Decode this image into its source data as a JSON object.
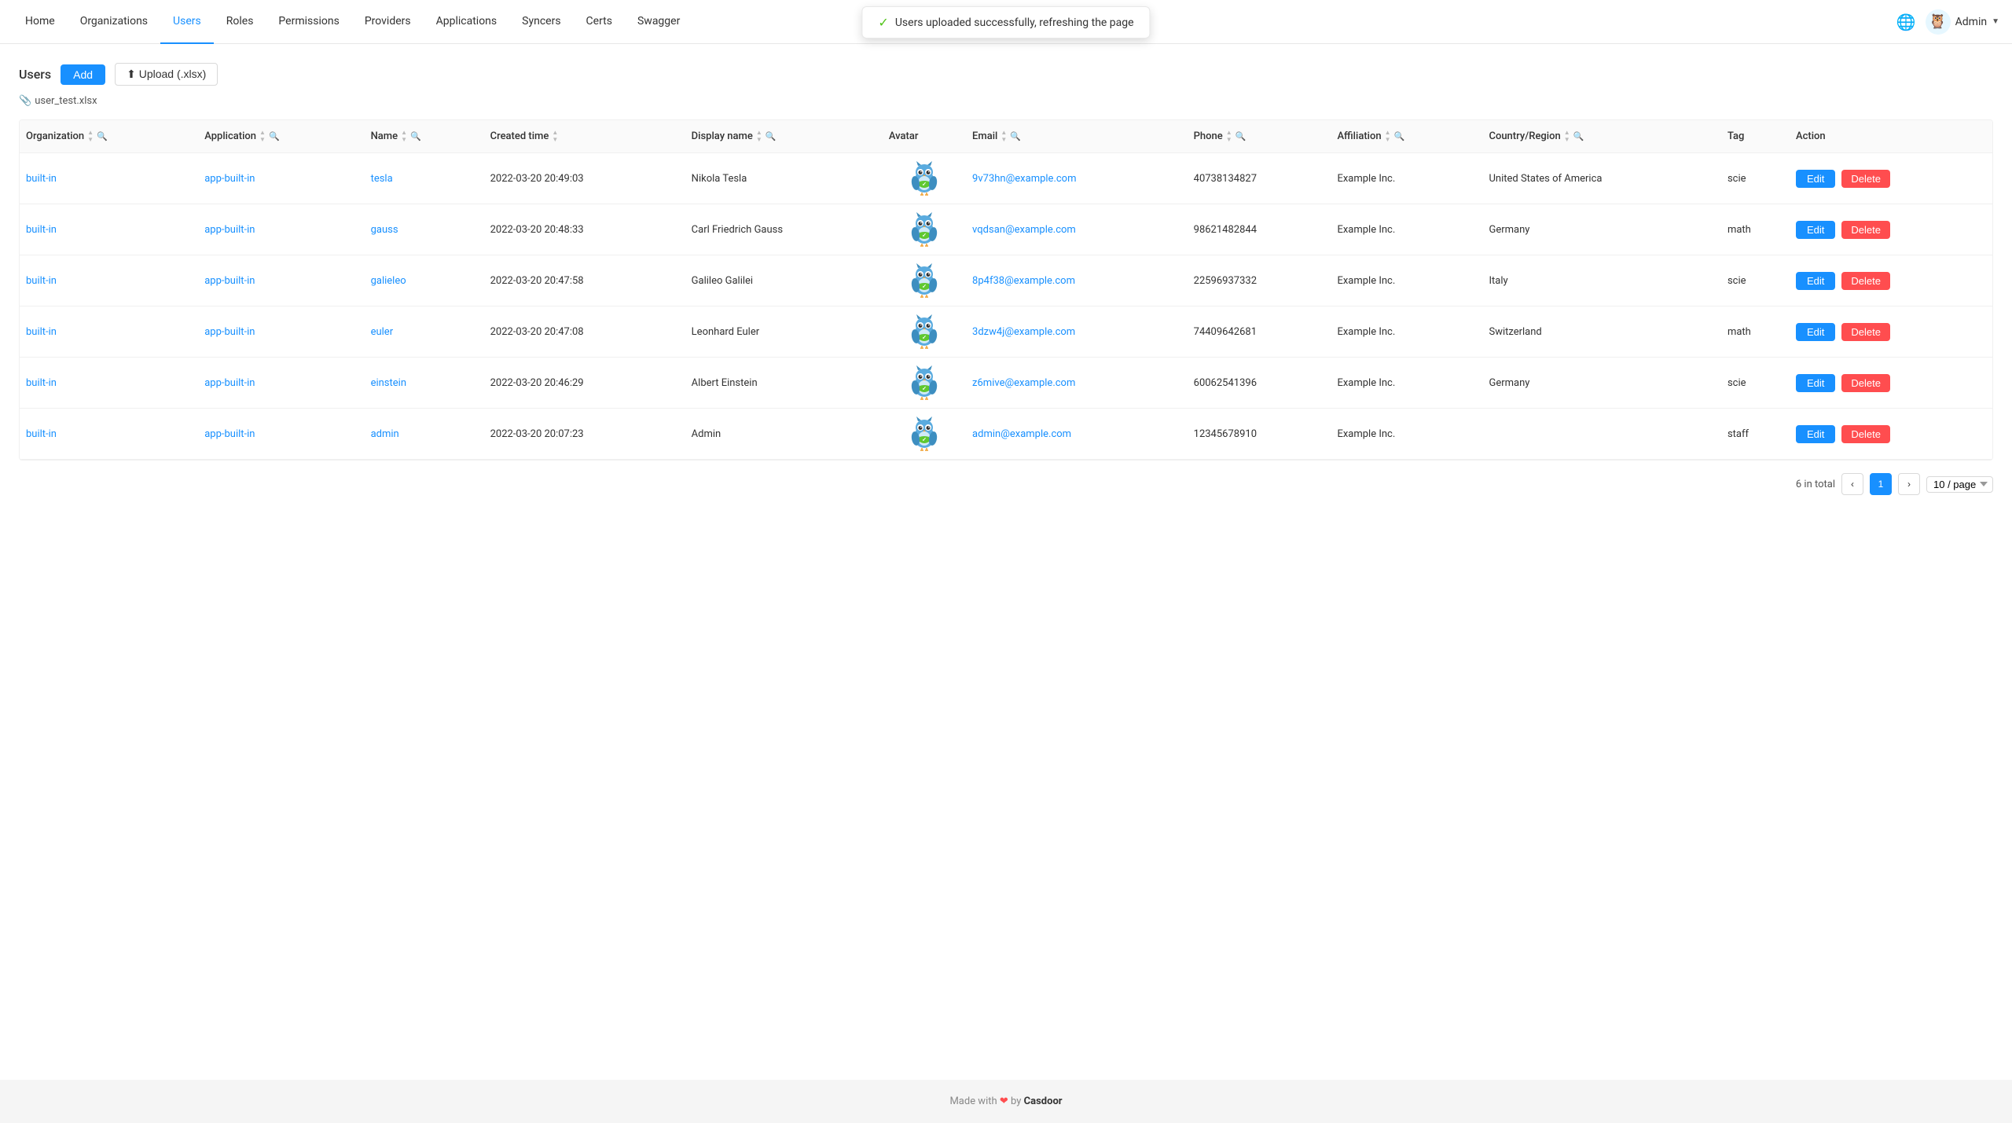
{
  "nav": {
    "items": [
      {
        "label": "Home",
        "active": false
      },
      {
        "label": "Organizations",
        "active": false
      },
      {
        "label": "Users",
        "active": true
      },
      {
        "label": "Roles",
        "active": false
      },
      {
        "label": "Permissions",
        "active": false
      },
      {
        "label": "Providers",
        "active": false
      },
      {
        "label": "Applications",
        "active": false
      },
      {
        "label": "Syncers",
        "active": false
      },
      {
        "label": "Certs",
        "active": false
      },
      {
        "label": "Swagger",
        "active": false
      }
    ],
    "admin_label": "Admin",
    "dropdown_arrow": "▼"
  },
  "toast": {
    "message": "Users uploaded successfully, refreshing the page",
    "icon": "✓"
  },
  "toolbar": {
    "page_title": "Users",
    "add_label": "Add",
    "upload_label": "⬆ Upload (.xlsx)",
    "file_name": "user_test.xlsx"
  },
  "table": {
    "columns": [
      {
        "label": "Organization",
        "key": "organization"
      },
      {
        "label": "Application",
        "key": "application"
      },
      {
        "label": "Name",
        "key": "name"
      },
      {
        "label": "Created time",
        "key": "created_time"
      },
      {
        "label": "Display name",
        "key": "display_name"
      },
      {
        "label": "Avatar",
        "key": "avatar"
      },
      {
        "label": "Email",
        "key": "email"
      },
      {
        "label": "Phone",
        "key": "phone"
      },
      {
        "label": "Affiliation",
        "key": "affiliation"
      },
      {
        "label": "Country/Region",
        "key": "country"
      },
      {
        "label": "Tag",
        "key": "tag"
      },
      {
        "label": "Action",
        "key": "action"
      }
    ],
    "rows": [
      {
        "organization": "built-in",
        "application": "app-built-in",
        "name": "tesla",
        "created_time": "2022-03-20 20:49:03",
        "display_name": "Nikola Tesla",
        "email": "9v73hn@example.com",
        "phone": "40738134827",
        "affiliation": "Example Inc.",
        "country": "United States of America",
        "tag": "scie"
      },
      {
        "organization": "built-in",
        "application": "app-built-in",
        "name": "gauss",
        "created_time": "2022-03-20 20:48:33",
        "display_name": "Carl Friedrich Gauss",
        "email": "vqdsan@example.com",
        "phone": "98621482844",
        "affiliation": "Example Inc.",
        "country": "Germany",
        "tag": "math"
      },
      {
        "organization": "built-in",
        "application": "app-built-in",
        "name": "galieleo",
        "created_time": "2022-03-20 20:47:58",
        "display_name": "Galileo Galilei",
        "email": "8p4f38@example.com",
        "phone": "22596937332",
        "affiliation": "Example Inc.",
        "country": "Italy",
        "tag": "scie"
      },
      {
        "organization": "built-in",
        "application": "app-built-in",
        "name": "euler",
        "created_time": "2022-03-20 20:47:08",
        "display_name": "Leonhard Euler",
        "email": "3dzw4j@example.com",
        "phone": "74409642681",
        "affiliation": "Example Inc.",
        "country": "Switzerland",
        "tag": "math"
      },
      {
        "organization": "built-in",
        "application": "app-built-in",
        "name": "einstein",
        "created_time": "2022-03-20 20:46:29",
        "display_name": "Albert Einstein",
        "email": "z6mive@example.com",
        "phone": "60062541396",
        "affiliation": "Example Inc.",
        "country": "Germany",
        "tag": "scie"
      },
      {
        "organization": "built-in",
        "application": "app-built-in",
        "name": "admin",
        "created_time": "2022-03-20 20:07:23",
        "display_name": "Admin",
        "email": "admin@example.com",
        "phone": "12345678910",
        "affiliation": "Example Inc.",
        "country": "",
        "tag": "staff"
      }
    ]
  },
  "pagination": {
    "total_text": "6 in total",
    "current_page": 1,
    "per_page": "10 / page"
  },
  "footer": {
    "prefix": "Made with",
    "heart": "❤",
    "suffix": "by",
    "brand": "Casdoor"
  },
  "buttons": {
    "edit": "Edit",
    "delete": "Delete"
  }
}
